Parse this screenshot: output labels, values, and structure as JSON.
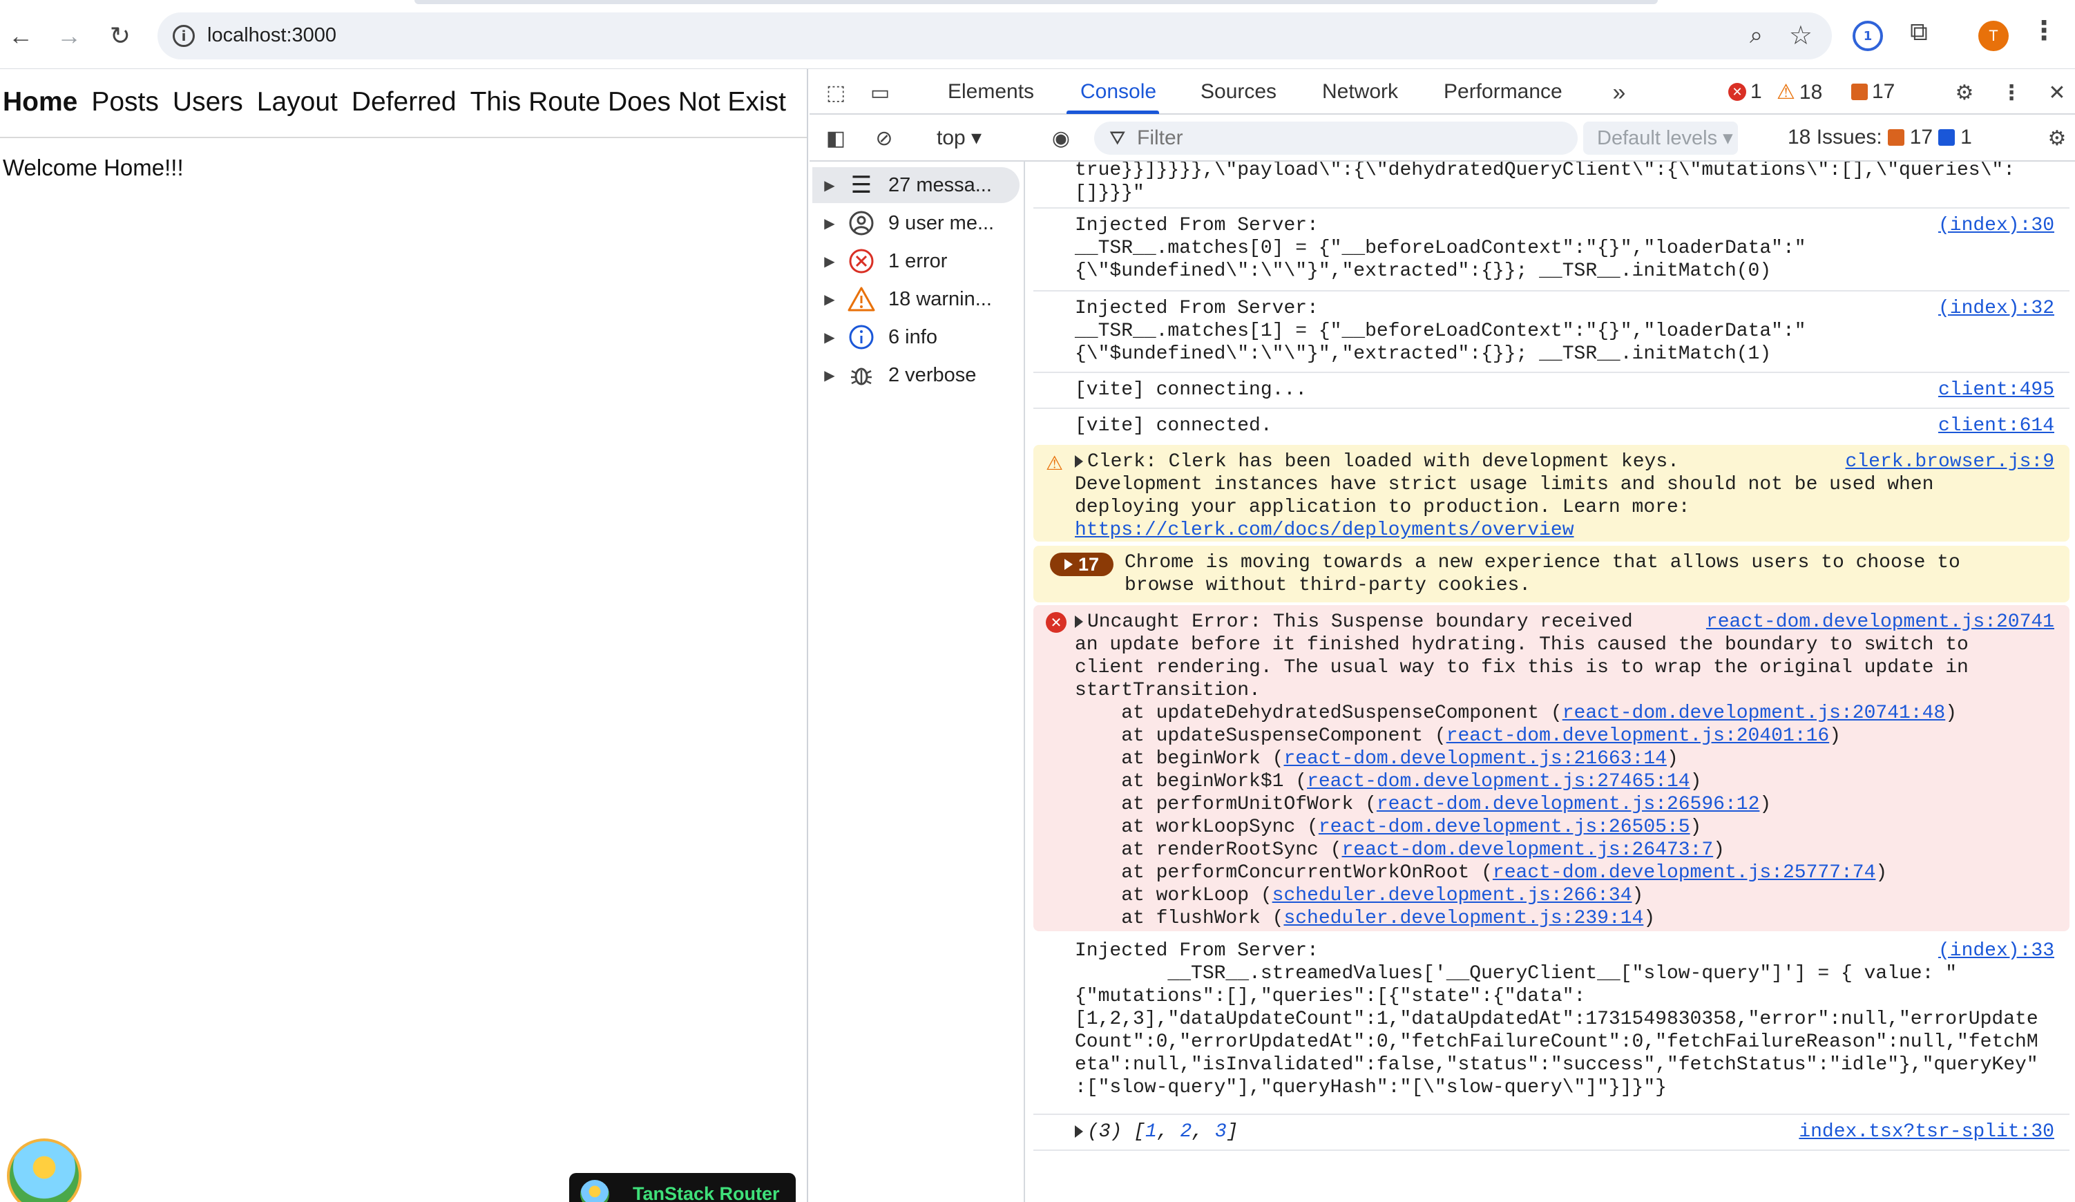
{
  "browser": {
    "url": "localhost:3000",
    "avatar_letter": "T",
    "icons": [
      "back-icon",
      "forward-icon",
      "reload-icon",
      "site-info-icon",
      "zoom-icon",
      "bookmark-star-icon",
      "password-manager-icon",
      "extensions-icon",
      "chrome-menu-icon"
    ]
  },
  "page": {
    "nav": [
      "Home",
      "Posts",
      "Users",
      "Layout",
      "Deferred",
      "This Route Does Not Exist"
    ],
    "welcome": "Welcome Home!!!",
    "router_badge": "TanStack Router"
  },
  "devtools": {
    "tabs": [
      "Elements",
      "Console",
      "Sources",
      "Network",
      "Performance"
    ],
    "active_tab": "Console",
    "error_count": "1",
    "warning_count": "18",
    "issue_count": "17",
    "toolbar": {
      "context": "top",
      "filter_placeholder": "Filter",
      "levels": "Default levels",
      "issues_label": "18 Issues:",
      "issues_orange": "17",
      "issues_blue": "1"
    },
    "sidebar": [
      {
        "label": "27 messa...",
        "icon": "list-icon"
      },
      {
        "label": "9 user me...",
        "icon": "user-icon"
      },
      {
        "label": "1 error",
        "icon": "error-icon"
      },
      {
        "label": "18 warnin...",
        "icon": "warning-icon"
      },
      {
        "label": "6 info",
        "icon": "info-icon"
      },
      {
        "label": "2 verbose",
        "icon": "bug-icon"
      }
    ],
    "log": {
      "m0": {
        "text": "true}}]}}}},\\\"payload\\\":{\\\"dehydratedQueryClient\\\":{\\\"mutations\\\":[],\\\"queries\\\":\n[]}}}\""
      },
      "m1": {
        "text": "Injected From Server:\n__TSR__.matches[0] = {\"__beforeLoadContext\":\"{}\",\"loaderData\":\"\n{\\\"$undefined\\\":\\\"\\\"}\",\"extracted\":{}}; __TSR__.initMatch(0)",
        "src": "(index):30"
      },
      "m2": {
        "text": "Injected From Server:\n__TSR__.matches[1] = {\"__beforeLoadContext\":\"{}\",\"loaderData\":\"\n{\\\"$undefined\\\":\\\"\\\"}\",\"extracted\":{}}; __TSR__.initMatch(1)",
        "src": "(index):32"
      },
      "m3": {
        "text": "[vite] connecting...",
        "src": "client:495"
      },
      "m4": {
        "text": "[vite] connected.",
        "src": "client:614"
      },
      "m5": {
        "line1": "Clerk: Clerk has been loaded with development keys.",
        "rest": "Development instances have strict usage limits and should not be used when\ndeploying your application to production. Learn more:",
        "link": "https://clerk.com/docs/deployments/overview",
        "src": "clerk.browser.js:9"
      },
      "m6": {
        "count": "17",
        "text": "Chrome is moving towards a new experience that allows users to choose to\nbrowse without third-party cookies."
      },
      "m7": {
        "line1": "Uncaught Error: This Suspense boundary received",
        "rest": "an update before it finished hydrating. This caused the boundary to switch to\nclient rendering. The usual way to fix this is to wrap the original update in\nstartTransition.",
        "src": "react-dom.development.js:20741",
        "stack": [
          {
            "fn": "    at updateDehydratedSuspenseComponent (",
            "loc": "react-dom.development.js:20741:48"
          },
          {
            "fn": "    at updateSuspenseComponent (",
            "loc": "react-dom.development.js:20401:16"
          },
          {
            "fn": "    at beginWork (",
            "loc": "react-dom.development.js:21663:14"
          },
          {
            "fn": "    at beginWork$1 (",
            "loc": "react-dom.development.js:27465:14"
          },
          {
            "fn": "    at performUnitOfWork (",
            "loc": "react-dom.development.js:26596:12"
          },
          {
            "fn": "    at workLoopSync (",
            "loc": "react-dom.development.js:26505:5"
          },
          {
            "fn": "    at renderRootSync (",
            "loc": "react-dom.development.js:26473:7"
          },
          {
            "fn": "    at performConcurrentWorkOnRoot (",
            "loc": "react-dom.development.js:25777:74"
          },
          {
            "fn": "    at workLoop (",
            "loc": "scheduler.development.js:266:34"
          },
          {
            "fn": "    at flushWork (",
            "loc": "scheduler.development.js:239:14"
          }
        ]
      },
      "m8": {
        "text": "Injected From Server:\n        __TSR__.streamedValues['__QueryClient__[\"slow-query\"]'] = { value: \"\n{\"mutations\":[],\"queries\":[{\"state\":{\"data\":\n[1,2,3],\"dataUpdateCount\":1,\"dataUpdatedAt\":1731549830358,\"error\":null,\"errorUpdate\nCount\":0,\"errorUpdatedAt\":0,\"fetchFailureCount\":0,\"fetchFailureReason\":null,\"fetchM\neta\":null,\"isInvalidated\":false,\"status\":\"success\",\"fetchStatus\":\"idle\"},\"queryKey\"\n:[\"slow-query\"],\"queryHash\":\"[\\\"slow-query\\\"]\"}]}\"}",
        "src": "(index):33"
      },
      "m9": {
        "prefix": "(3) [",
        "n1": "1",
        "n2": "2",
        "n3": "3",
        "suffix": "]",
        "src": "index.tsx?tsr-split:30"
      }
    },
    "prompt": "›"
  }
}
